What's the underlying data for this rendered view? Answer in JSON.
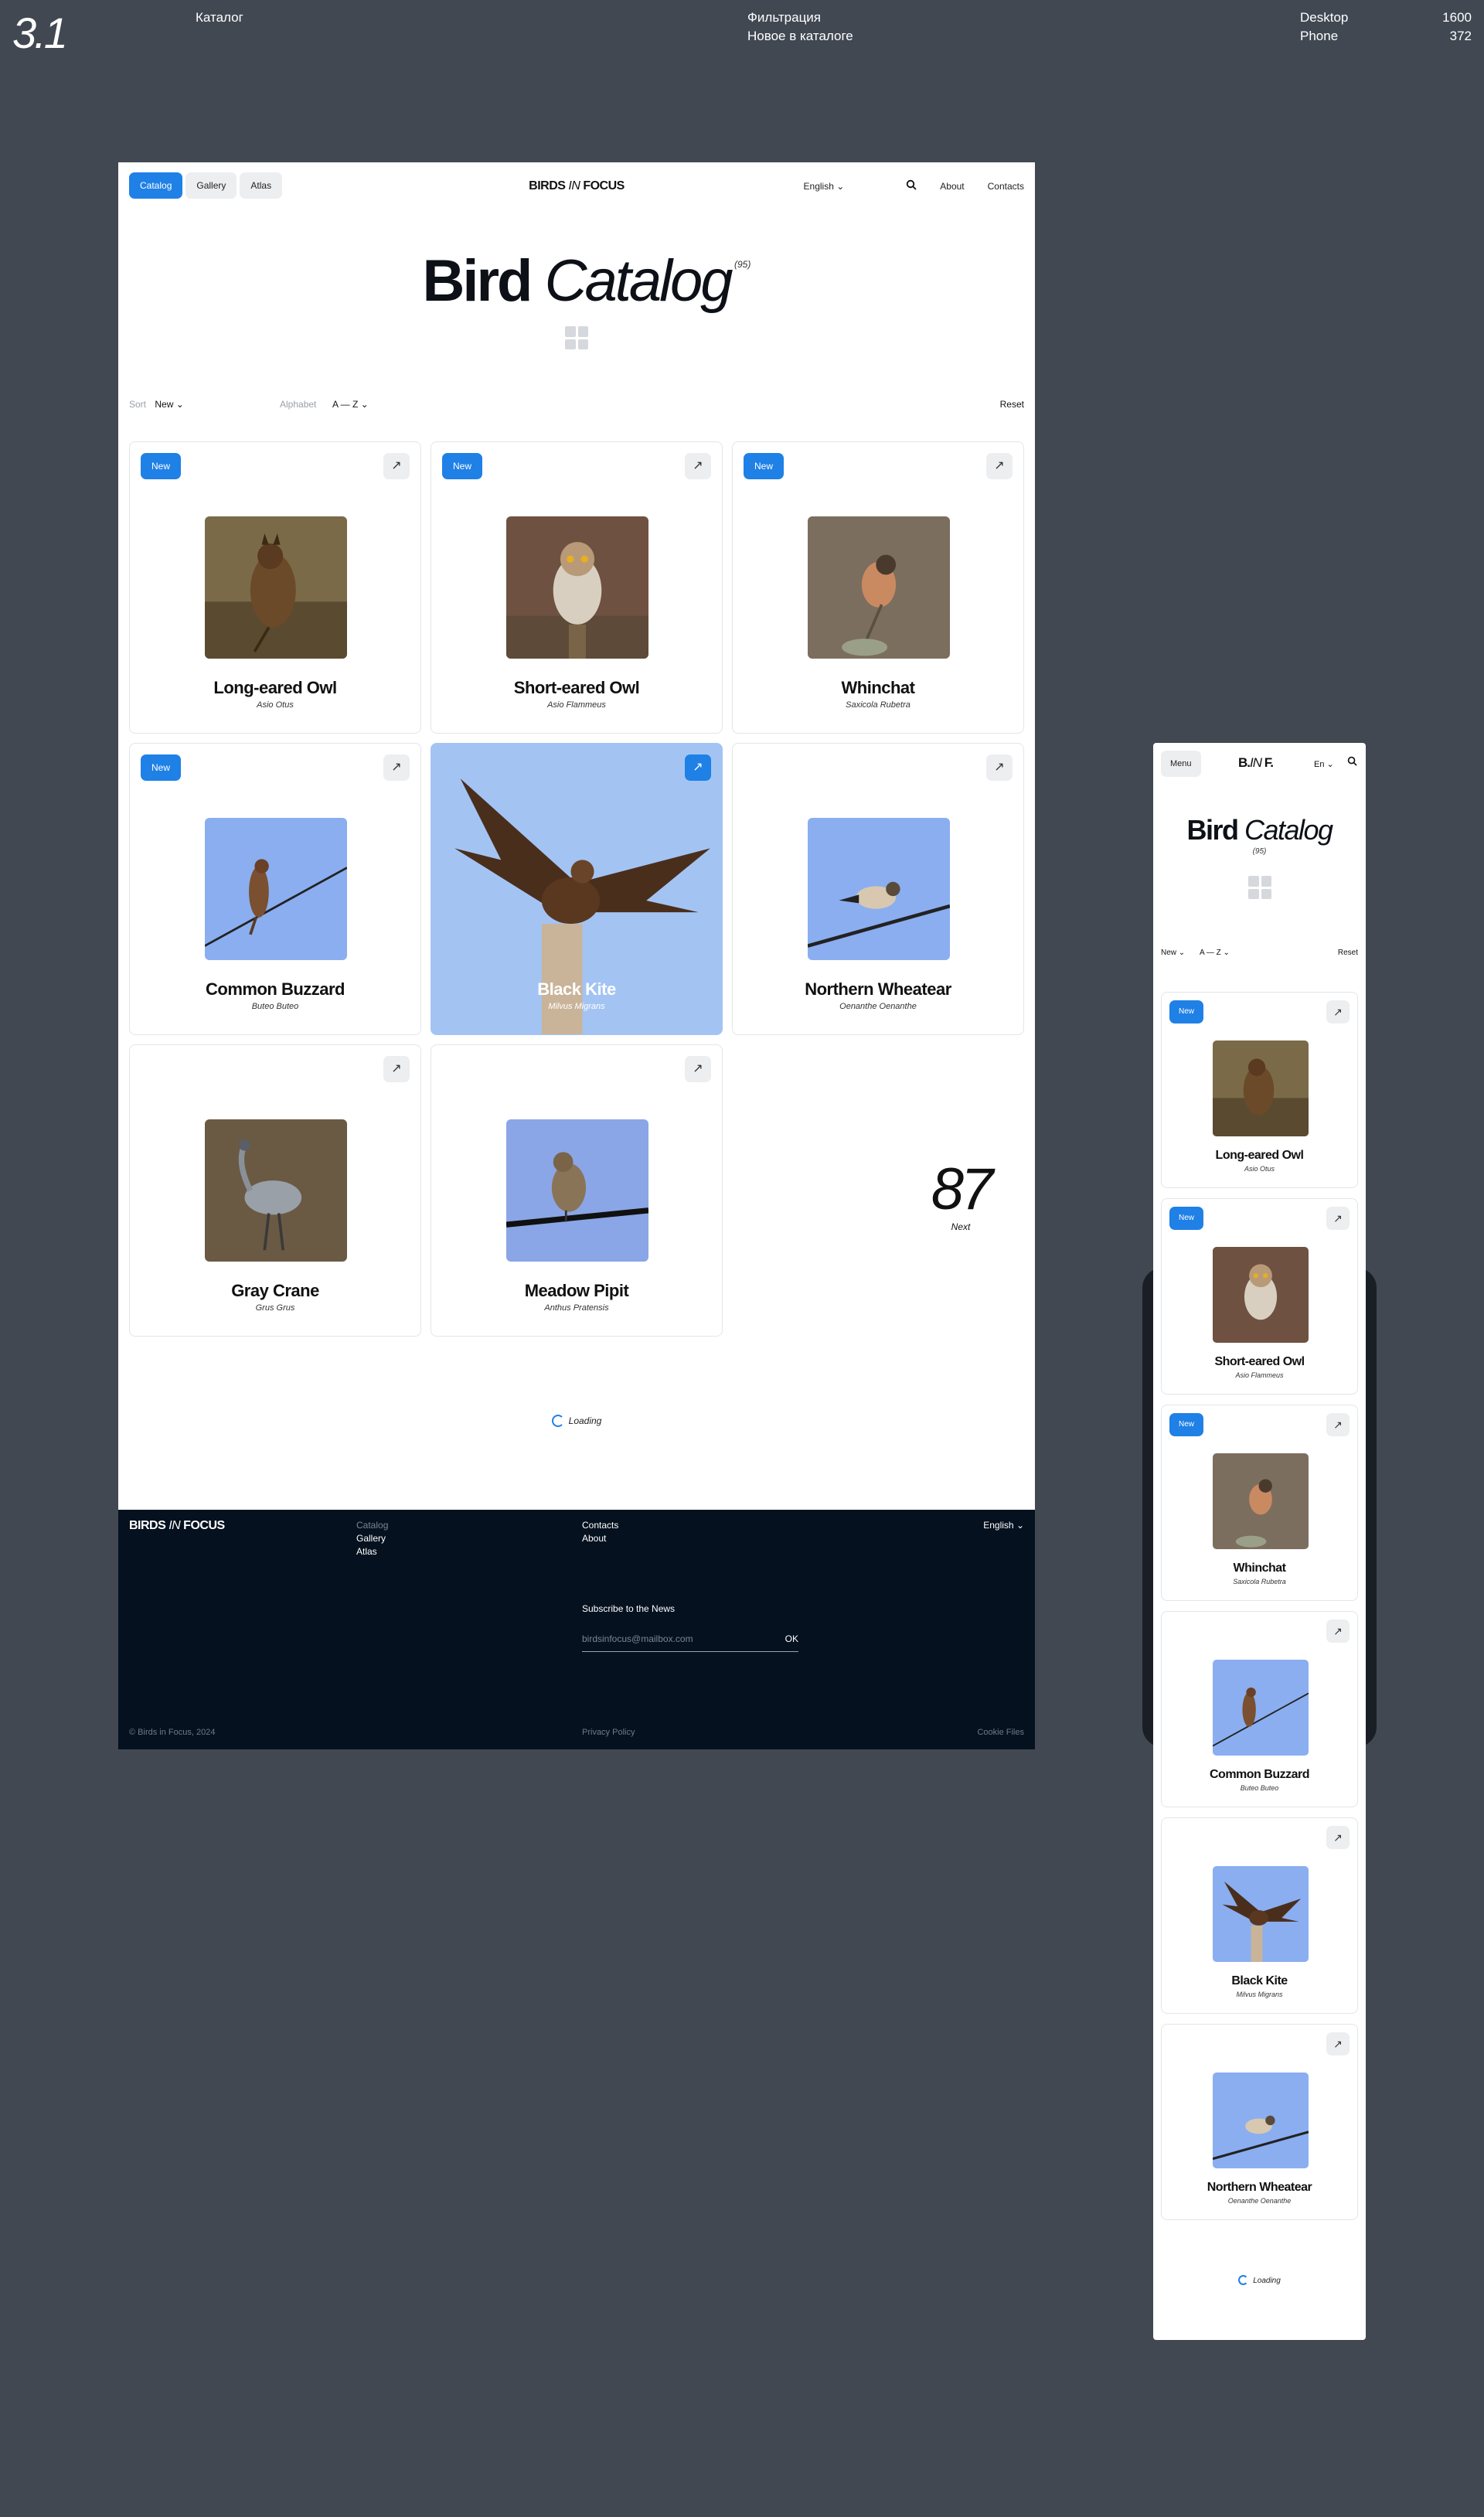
{
  "presentation": {
    "number": "3.1",
    "section": "Каталог",
    "topic_line1": "Фильтрация",
    "topic_line2": "Новое в каталоге",
    "device1": "Desktop",
    "device1_width": "1600",
    "device2": "Phone",
    "device2_width": "372"
  },
  "desktop": {
    "nav": [
      "Catalog",
      "Gallery",
      "Atlas"
    ],
    "logo_a": "BIRDS ",
    "logo_b": "IN",
    "logo_c": " FOCUS",
    "language": "English",
    "links": [
      "About",
      "Contacts"
    ],
    "title_bold": "Bird",
    "title_italic": " Catalog",
    "count": "(95)",
    "sort_label": "Sort",
    "sort_value": "New",
    "alphabet_label": "Alphabet",
    "alphabet_value": "A — Z",
    "reset": "Reset",
    "badge": "New",
    "arrow": "↗",
    "cards": [
      {
        "name": "Long-eared Owl",
        "latin": "Asio Otus",
        "is_new": true
      },
      {
        "name": "Short-eared Owl",
        "latin": "Asio Flammeus",
        "is_new": true
      },
      {
        "name": "Whinchat",
        "latin": "Saxicola Rubetra",
        "is_new": true
      },
      {
        "name": "Common Buzzard",
        "latin": "Buteo Buteo",
        "is_new": true
      },
      {
        "name": "Black Kite",
        "latin": "Milvus Migrans",
        "is_new": false,
        "highlighted": true
      },
      {
        "name": "Northern Wheatear",
        "latin": "Oenanthe Oenanthe",
        "is_new": false
      },
      {
        "name": "Gray Crane",
        "latin": "Grus Grus",
        "is_new": false
      },
      {
        "name": "Meadow Pipit",
        "latin": "Anthus Pratensis",
        "is_new": false
      }
    ],
    "next_count": "87",
    "next_label": "Next",
    "loading": "Loading"
  },
  "footer": {
    "logo_a": "BIRDS ",
    "logo_b": "IN",
    "logo_c": " FOCUS",
    "col1": [
      "Catalog",
      "Gallery",
      "Atlas"
    ],
    "col2": [
      "Contacts",
      "About"
    ],
    "language": "English",
    "subscribe": "Subscribe to the News",
    "email_placeholder": "birdsinfocus@mailbox.com",
    "ok": "OK",
    "copyright": "© Birds in Focus, 2024",
    "privacy": "Privacy Policy",
    "cookie": "Cookie Files"
  },
  "phone": {
    "menu": "Menu",
    "logo_a": "B.",
    "logo_b": "IN",
    "logo_c": " F.",
    "language": "En",
    "title_bold": "Bird",
    "title_italic": " Catalog",
    "count": "(95)",
    "sort_value": "New",
    "alphabet_value": "A — Z",
    "reset": "Reset",
    "badge": "New",
    "arrow": "↗",
    "cards": [
      {
        "name": "Long-eared Owl",
        "latin": "Asio Otus",
        "is_new": true
      },
      {
        "name": "Short-eared Owl",
        "latin": "Asio Flammeus",
        "is_new": true
      },
      {
        "name": "Whinchat",
        "latin": "Saxicola Rubetra",
        "is_new": true
      },
      {
        "name": "Common Buzzard",
        "latin": "Buteo Buteo",
        "is_new": false
      },
      {
        "name": "Black Kite",
        "latin": "Milvus Migrans",
        "is_new": false
      },
      {
        "name": "Northern Wheatear",
        "latin": "Oenanthe Oenanthe",
        "is_new": false
      }
    ],
    "loading": "Loading"
  },
  "colors": {
    "background": "#414852",
    "accent": "#1f80e6",
    "footer": "#05111f",
    "sky": "#8aaef0"
  }
}
